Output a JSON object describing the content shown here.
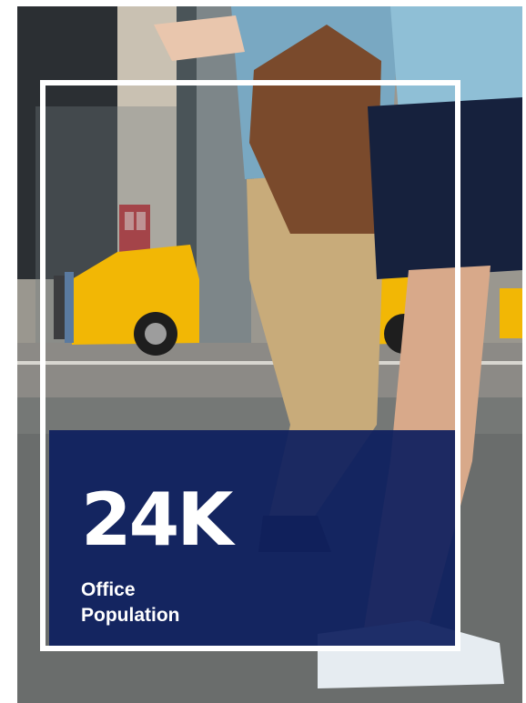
{
  "stat": {
    "number": "24K",
    "label_line1": "Office",
    "label_line2": "Population"
  },
  "colors": {
    "panel": "#0e1f5f",
    "frame": "#ffffff",
    "taxi": "#f2b705"
  }
}
